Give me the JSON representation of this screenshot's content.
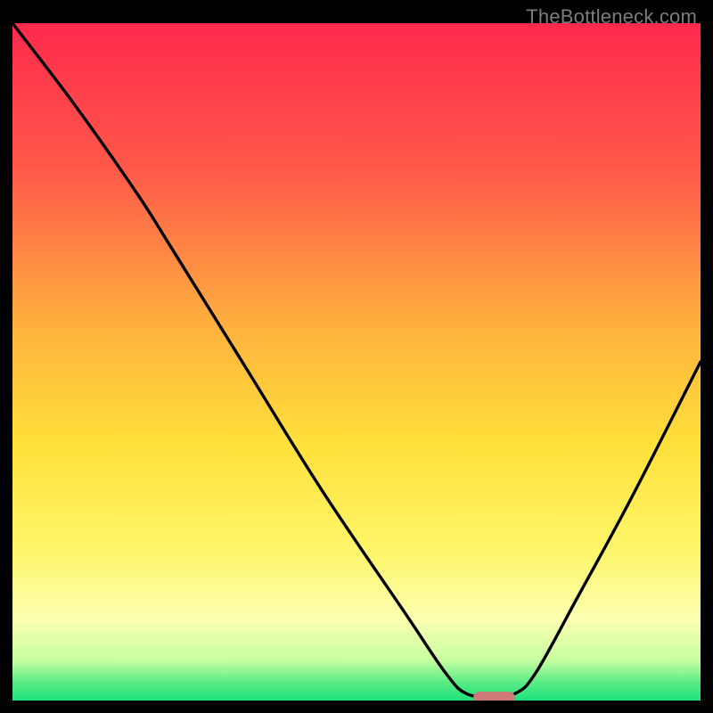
{
  "watermark": "TheBottleneck.com",
  "chart_data": {
    "type": "line",
    "title": "",
    "xlabel": "",
    "ylabel": "",
    "xlim": [
      0,
      100
    ],
    "ylim": [
      0,
      100
    ],
    "grid": false,
    "curve_points": [
      {
        "x": 0.0,
        "y": 100.0
      },
      {
        "x": 9.0,
        "y": 88.0
      },
      {
        "x": 18.0,
        "y": 75.0
      },
      {
        "x": 23.0,
        "y": 67.0
      },
      {
        "x": 34.0,
        "y": 49.0
      },
      {
        "x": 45.0,
        "y": 31.0
      },
      {
        "x": 57.0,
        "y": 13.0
      },
      {
        "x": 63.0,
        "y": 4.0
      },
      {
        "x": 66.0,
        "y": 1.0
      },
      {
        "x": 70.0,
        "y": 0.5
      },
      {
        "x": 73.0,
        "y": 1.0
      },
      {
        "x": 76.0,
        "y": 4.0
      },
      {
        "x": 82.0,
        "y": 15.0
      },
      {
        "x": 90.0,
        "y": 30.0
      },
      {
        "x": 100.0,
        "y": 50.0
      }
    ],
    "marker": {
      "shape": "capsule",
      "cx": 70.0,
      "cy": 0.5,
      "width_pct": 6.0,
      "height_pct": 1.6,
      "color": "#cf7a79"
    },
    "background": {
      "type": "vertical-gradient",
      "stops": [
        {
          "offset": 0.0,
          "color": "#ff2a4d"
        },
        {
          "offset": 0.22,
          "color": "#ff5a4a"
        },
        {
          "offset": 0.45,
          "color": "#ffb23e"
        },
        {
          "offset": 0.62,
          "color": "#ffe03a"
        },
        {
          "offset": 0.78,
          "color": "#fff66b"
        },
        {
          "offset": 0.88,
          "color": "#fbffb0"
        },
        {
          "offset": 0.94,
          "color": "#c8ffa0"
        },
        {
          "offset": 0.975,
          "color": "#55eb86"
        },
        {
          "offset": 1.0,
          "color": "#1de27a"
        }
      ]
    }
  }
}
